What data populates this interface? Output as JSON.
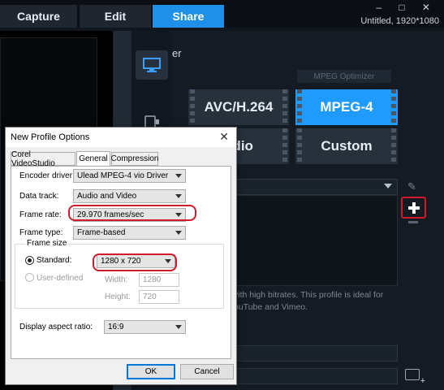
{
  "window": {
    "tabs": [
      "Capture",
      "Edit",
      "Share"
    ],
    "active_tab": "Share",
    "controls": "– □ ✕",
    "project_info": "Untitled, 1920*1080"
  },
  "share_panel": {
    "header_fragment": "er",
    "mpeg_optimizer_label": "MPEG Optimizer",
    "formats": [
      "AVC/H.264",
      "MPEG-4",
      "udio",
      "Custom"
    ],
    "selected_format": "MPEG-4",
    "description_fragment": "vith high bitrates. This profile is ideal for\nouTube and Vimeo."
  },
  "dialog": {
    "title": "New Profile Options",
    "close_glyph": "✕",
    "tabs": [
      "Corel VideoStudio",
      "General",
      "Compression"
    ],
    "active_tab": "General",
    "encoder_driver_label": "Encoder driver:",
    "encoder_driver_value": "Ulead MPEG-4 vio Driver",
    "data_track_label": "Data track:",
    "data_track_value": "Audio and Video",
    "frame_rate_label": "Frame rate:",
    "frame_rate_value": "29.970 frames/sec",
    "frame_type_label": "Frame type:",
    "frame_type_value": "Frame-based",
    "frame_size_group": "Frame size",
    "standard_label": "Standard:",
    "standard_value": "1280 x 720",
    "user_defined_label": "User-defined",
    "width_label": "Width:",
    "width_value": "1280",
    "height_label": "Height:",
    "height_value": "720",
    "display_aspect_label": "Display aspect ratio:",
    "display_aspect_value": "16:9",
    "ok_label": "OK",
    "cancel_label": "Cancel"
  },
  "colors": {
    "accent_blue": "#1e90e8",
    "highlight_red": "#d11a2a",
    "dark_bg": "#10161d"
  }
}
